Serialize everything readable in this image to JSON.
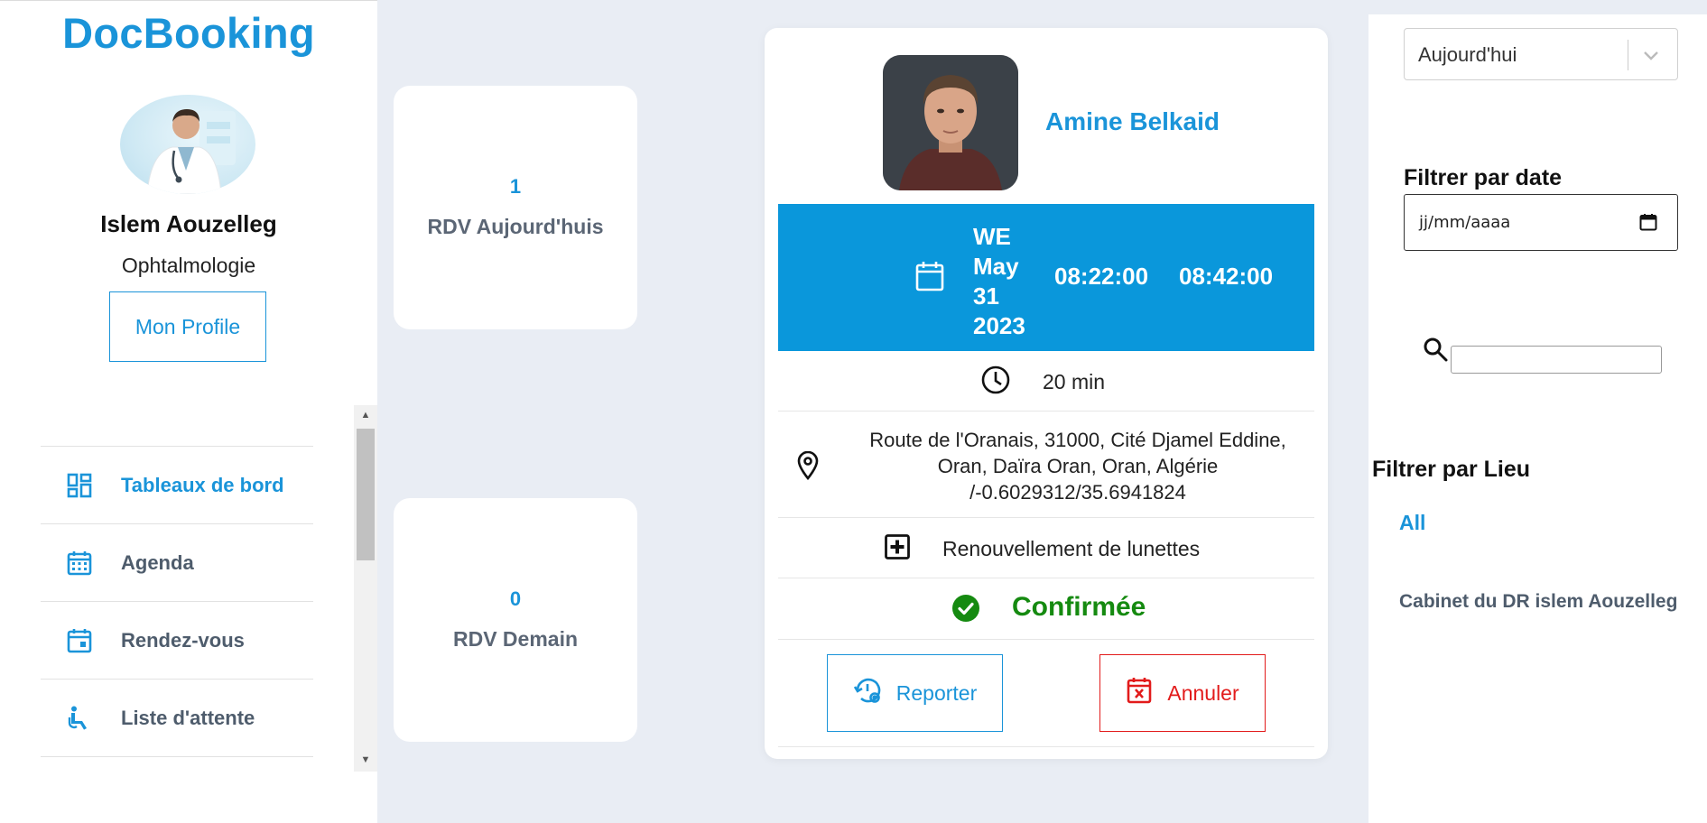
{
  "brand": "DocBooking",
  "doctor": {
    "name": "Islem Aouzelleg",
    "specialty": "Ophtalmologie",
    "profile_button": "Mon Profile"
  },
  "nav": {
    "items": [
      {
        "label": "Tableaux de bord",
        "icon": "dashboard-icon",
        "active": true
      },
      {
        "label": "Agenda",
        "icon": "calendar-month-icon"
      },
      {
        "label": "Rendez-vous",
        "icon": "calendar-day-icon"
      },
      {
        "label": "Liste d'attente",
        "icon": "wheelchair-icon"
      }
    ]
  },
  "stats": {
    "today": {
      "value": "1",
      "label": "RDV Aujourd'huis"
    },
    "tomorrow": {
      "value": "0",
      "label": "RDV Demain"
    }
  },
  "appointment": {
    "patient_name": "Amine Belkaid",
    "date_lines": [
      "WE",
      "May",
      "31",
      "2023"
    ],
    "start_time": "08:22:00",
    "end_time": "08:42:00",
    "duration": "20 min",
    "address_lines": [
      "Route de l'Oranais, 31000, Cité Djamel Eddine,",
      "Oran, Daïra Oran, Oran, Algérie",
      "/-0.6029312/35.6941824"
    ],
    "reason": "Renouvellement de lunettes",
    "status": "Confirmée",
    "reschedule_button": "Reporter",
    "cancel_button": "Annuler"
  },
  "filters": {
    "period_select": "Aujourd'hui",
    "date_heading": "Filtrer par date",
    "date_placeholder": "jj/mm/aaaa",
    "location_heading": "Filtrer par Lieu",
    "locations": [
      "All",
      "Cabinet du DR islem Aouzelleg"
    ]
  },
  "colors": {
    "brand": "#1a94d9",
    "date_band": "#0a97db",
    "confirmed": "#158a10",
    "cancel": "#e21b1b"
  }
}
